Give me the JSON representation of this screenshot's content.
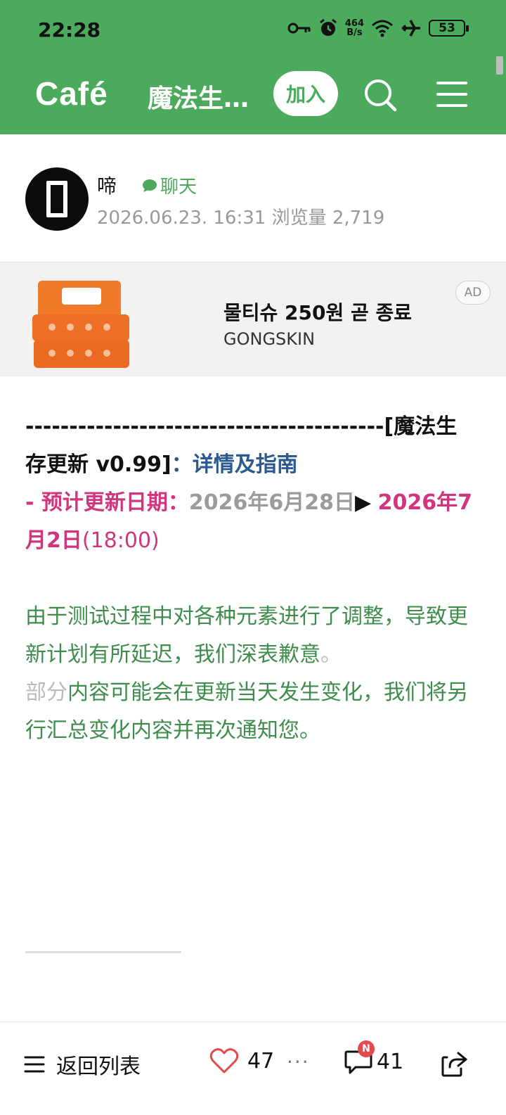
{
  "status_bar": {
    "time": "22:28",
    "net_speed_top": "464",
    "net_speed_bottom": "B/s",
    "battery": "53"
  },
  "header": {
    "logo": "Café",
    "title": "魔法生…",
    "join_label": "加入"
  },
  "author": {
    "name": "啼",
    "chat_label": "聊天",
    "meta": "2026.06.23. 16:31 浏览量 2,719"
  },
  "ad": {
    "title": "물티슈 250원 곧 종료",
    "brand": "GONGSKIN",
    "badge": "AD"
  },
  "content": {
    "line1_dashes": "-----------------------------------------",
    "line1_title": "[魔法生存更新 v0.99]",
    "line1_colon": "：",
    "line1_link": "详情及指南",
    "line2_label": "- 预计更新日期：",
    "line2_old_date": "2026年6月28日",
    "line2_arrow": "▶",
    "line2_new_date": "2026年7月2日",
    "line2_time": "(18:00)",
    "para1": "由于测试过程中对各种元素进行了调整，导致更新计划有所延迟，我们深表歉意",
    "para1_end": "。",
    "para2_faded": "部分",
    "para2": "内容可能会在更新当天发生变化，我们将另行汇总变化内容并再次通知您。"
  },
  "bottom_bar": {
    "back_label": "返回列表",
    "like_count": "47",
    "more": "···",
    "comment_badge": "N",
    "comment_count": "41"
  },
  "colors": {
    "brand_green": "#4caa5c",
    "accent_pink": "#d0357e",
    "link_blue": "#2a5a8f",
    "text_green": "#3e8d4c"
  }
}
